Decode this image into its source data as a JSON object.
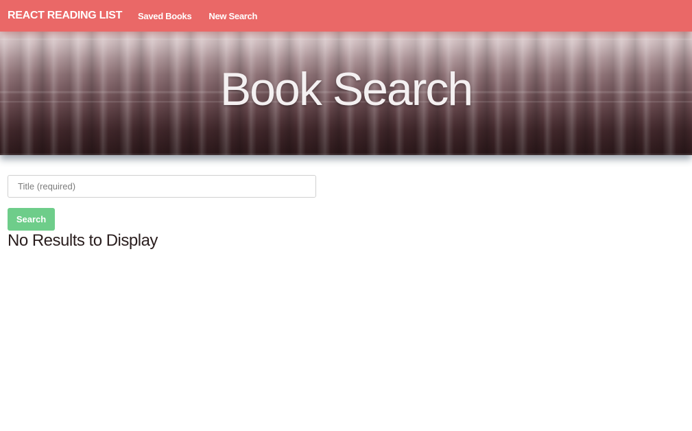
{
  "navbar": {
    "brand": "REACT READING LIST",
    "links": [
      {
        "label": "Saved Books"
      },
      {
        "label": "New Search"
      }
    ],
    "color": "#ea6867"
  },
  "hero": {
    "title": "Book Search"
  },
  "search": {
    "placeholder": "Title (required)",
    "value": "",
    "button_label": "Search",
    "button_color": "#6ecd8a"
  },
  "results": {
    "message": "No Results to Display"
  }
}
